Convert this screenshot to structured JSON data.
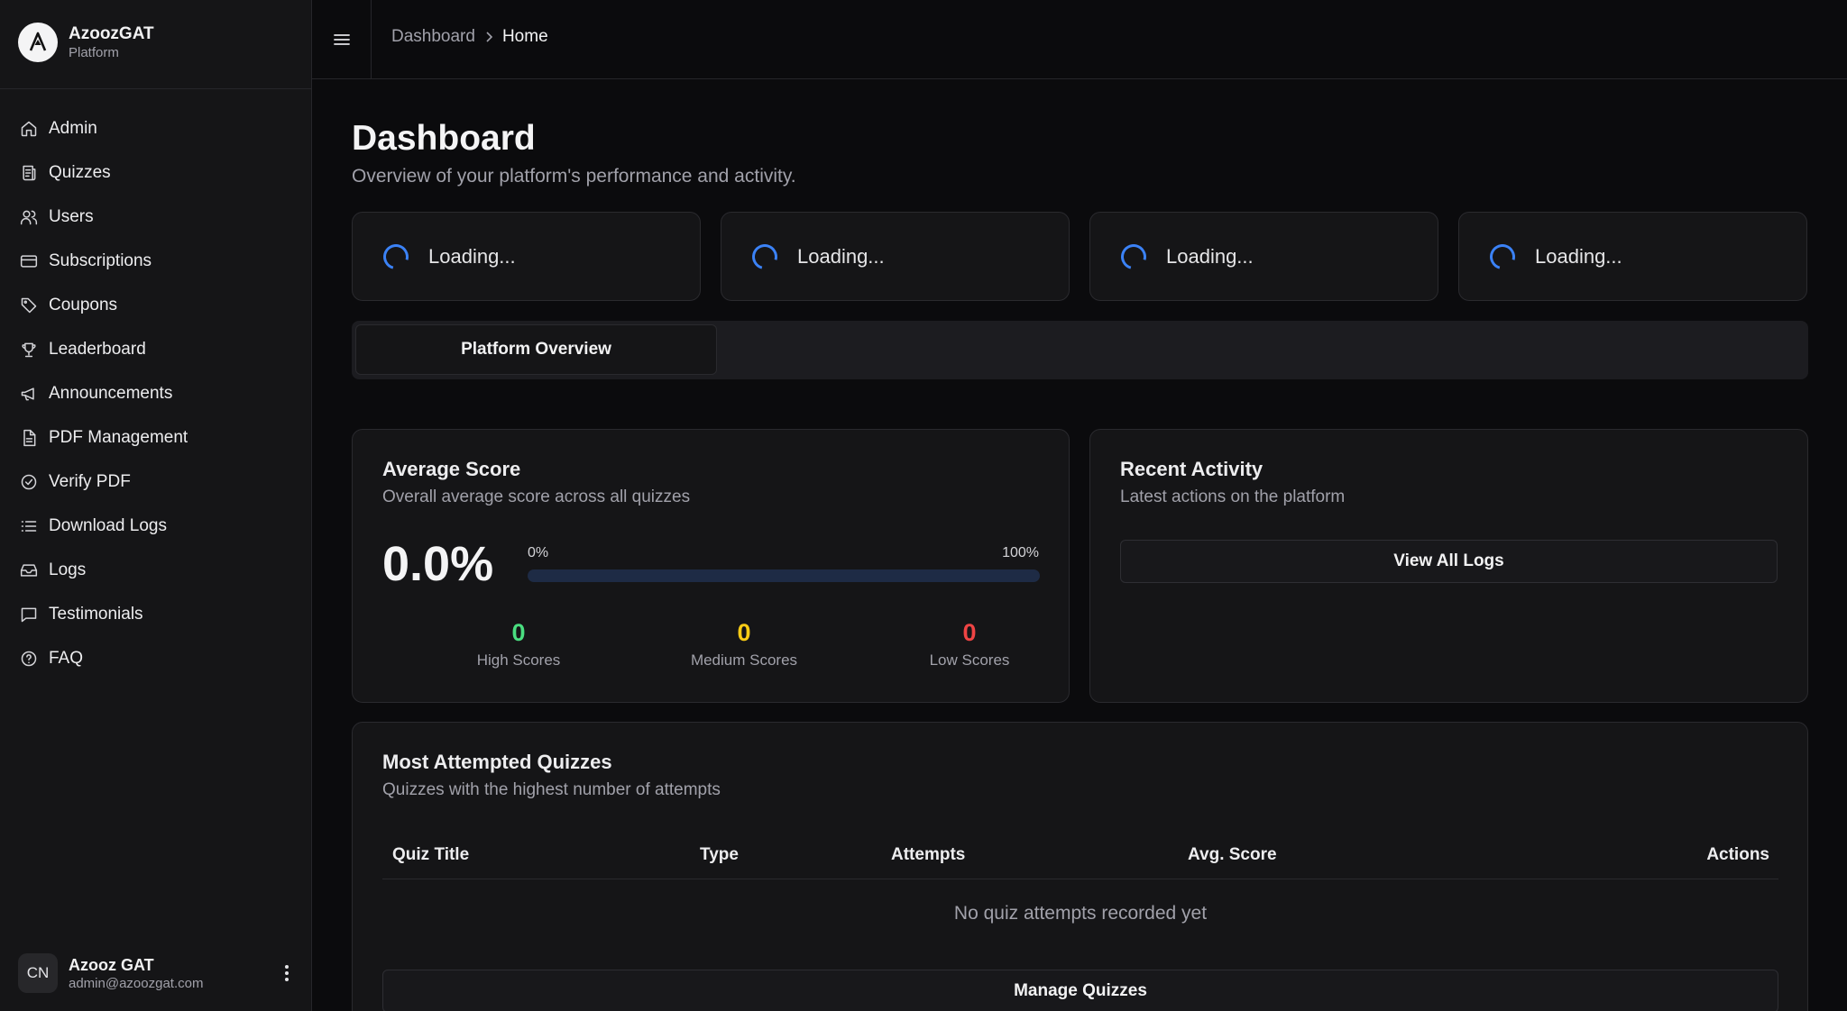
{
  "brand": {
    "name": "AzoozGAT",
    "subtitle": "Platform"
  },
  "sidebar": {
    "items": [
      {
        "label": "Admin",
        "icon": "home-icon"
      },
      {
        "label": "Quizzes",
        "icon": "quiz-icon"
      },
      {
        "label": "Users",
        "icon": "users-icon"
      },
      {
        "label": "Subscriptions",
        "icon": "credit-card-icon"
      },
      {
        "label": "Coupons",
        "icon": "tag-icon"
      },
      {
        "label": "Leaderboard",
        "icon": "trophy-icon"
      },
      {
        "label": "Announcements",
        "icon": "megaphone-icon"
      },
      {
        "label": "PDF Management",
        "icon": "file-icon"
      },
      {
        "label": "Verify PDF",
        "icon": "check-circle-icon"
      },
      {
        "label": "Download Logs",
        "icon": "list-icon"
      },
      {
        "label": "Logs",
        "icon": "inbox-icon"
      },
      {
        "label": "Testimonials",
        "icon": "message-icon"
      },
      {
        "label": "FAQ",
        "icon": "help-circle-icon"
      }
    ]
  },
  "user": {
    "initials": "CN",
    "name": "Azooz GAT",
    "email": "admin@azoozgat.com"
  },
  "header": {
    "breadcrumb": [
      "Dashboard",
      "Home"
    ]
  },
  "page": {
    "title": "Dashboard",
    "subtitle": "Overview of your platform's performance and activity."
  },
  "stats": [
    "Loading...",
    "Loading...",
    "Loading...",
    "Loading..."
  ],
  "tabs": [
    {
      "label": "Platform Overview",
      "active": true
    }
  ],
  "average_score": {
    "title": "Average Score",
    "description": "Overall average score across all quizzes",
    "value": "0.0%",
    "progress_fraction": 0.0,
    "progress_min": "0%",
    "progress_max": "100%",
    "high": {
      "value": "0",
      "label": "High Scores",
      "color": "#4ade80"
    },
    "medium": {
      "value": "0",
      "label": "Medium Scores",
      "color": "#facc15"
    },
    "low": {
      "value": "0",
      "label": "Low Scores",
      "color": "#ef4444"
    }
  },
  "recent_activity": {
    "title": "Recent Activity",
    "description": "Latest actions on the platform",
    "button": "View All Logs"
  },
  "most_attempted": {
    "title": "Most Attempted Quizzes",
    "description": "Quizzes with the highest number of attempts",
    "columns": [
      "Quiz Title",
      "Type",
      "Attempts",
      "Avg. Score",
      "Actions"
    ],
    "empty": "No quiz attempts recorded yet",
    "button": "Manage Quizzes"
  },
  "colors": {
    "accent": "#3b82f6",
    "background": "#0b0b0d",
    "card": "#151517"
  }
}
